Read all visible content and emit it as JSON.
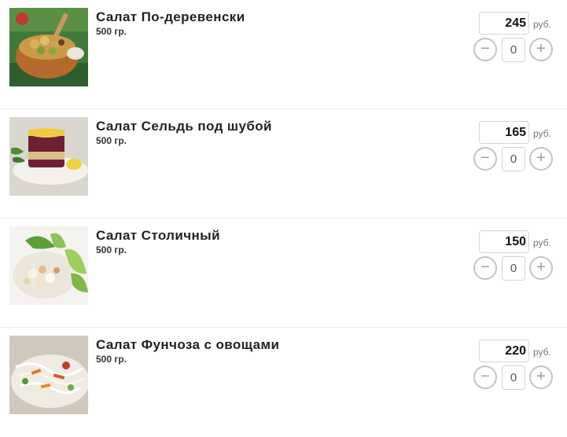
{
  "products": [
    {
      "title": "Салат По-деревенски",
      "weight": "500 гр.",
      "price": "245",
      "currency": "руб.",
      "quantity": "0",
      "minus_label": "−",
      "plus_label": "+",
      "image_icon": "salad-photo-potato-mushroom-bowl"
    },
    {
      "title": "Салат Сельдь под шубой",
      "weight": "500 гр.",
      "price": "165",
      "currency": "руб.",
      "quantity": "0",
      "minus_label": "−",
      "plus_label": "+",
      "image_icon": "salad-photo-herring-under-fur-coat"
    },
    {
      "title": "Салат Столичный",
      "weight": "500 гр.",
      "price": "150",
      "currency": "руб.",
      "quantity": "0",
      "minus_label": "−",
      "plus_label": "+",
      "image_icon": "salad-photo-stolichny-cucumber"
    },
    {
      "title": "Салат Фунчоза с овощами",
      "weight": "500 гр.",
      "price": "220",
      "currency": "руб.",
      "quantity": "0",
      "minus_label": "−",
      "plus_label": "+",
      "image_icon": "salad-photo-funchoza-vegetables"
    }
  ],
  "colors": {
    "button_border": "#c4c4c4",
    "divider": "#ececec",
    "title_text": "#222222"
  }
}
